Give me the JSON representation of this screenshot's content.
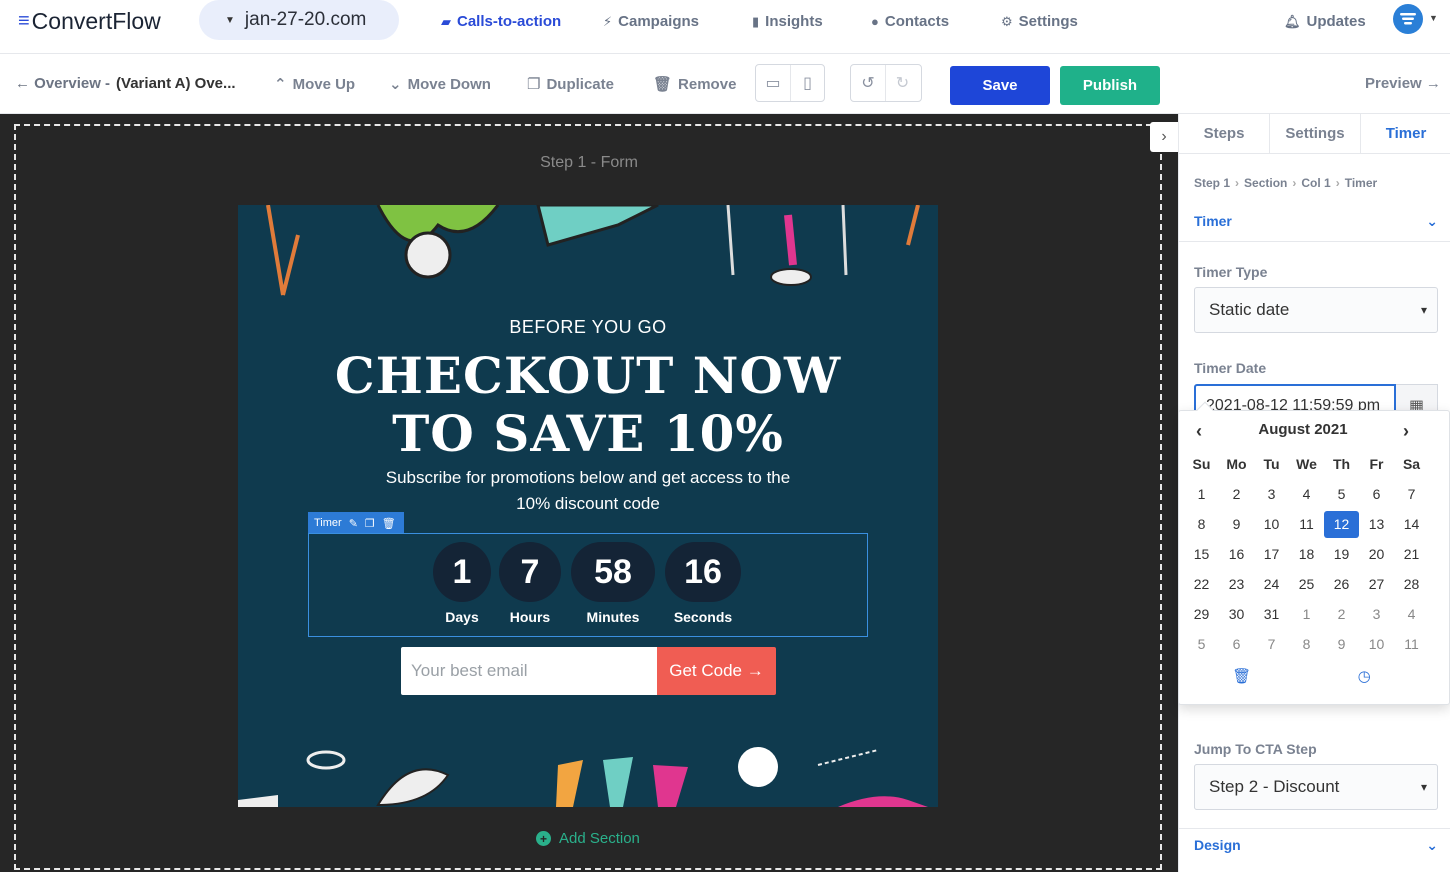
{
  "app": {
    "logo_text": "ConvertFlow",
    "domain": "jan-27-20.com"
  },
  "nav": {
    "items": [
      {
        "label": "Calls-to-action",
        "icon": "chat-icon",
        "active": true
      },
      {
        "label": "Campaigns",
        "icon": "bolt-icon",
        "active": false
      },
      {
        "label": "Insights",
        "icon": "bar-chart-icon",
        "active": false
      },
      {
        "label": "Contacts",
        "icon": "user-icon",
        "active": false
      },
      {
        "label": "Settings",
        "icon": "gear-icon",
        "active": false
      }
    ],
    "updates_label": "Updates"
  },
  "toolbar": {
    "back_label": "← Overview - ",
    "variant_label": "(Variant A) Ove...",
    "move_up": "Move Up",
    "move_down": "Move Down",
    "duplicate": "Duplicate",
    "remove": "Remove",
    "save": "Save",
    "publish": "Publish",
    "preview": "Preview →"
  },
  "canvas": {
    "step_label": "Step 1 - Form",
    "pre_headline": "BEFORE YOU GO",
    "headline_line1": "CHECKOUT NOW",
    "headline_line2": "TO SAVE 10%",
    "subtext": "Subscribe for promotions below and get access to the 10% discount code",
    "timer_tag": "Timer",
    "timer": [
      {
        "value": "1",
        "label": "Days"
      },
      {
        "value": "7",
        "label": "Hours"
      },
      {
        "value": "58",
        "label": "Minutes"
      },
      {
        "value": "16",
        "label": "Seconds"
      }
    ],
    "email_placeholder": "Your best email",
    "cta_button": "Get Code →",
    "add_section": "Add Section"
  },
  "panel": {
    "tabs": [
      "Steps",
      "Settings",
      "Timer"
    ],
    "active_tab": "Timer",
    "breadcrumbs": [
      "Step 1",
      "Section",
      "Col 1",
      "Timer"
    ],
    "timer_section": "Timer",
    "timer_type_label": "Timer Type",
    "timer_type_value": "Static date",
    "timer_date_label": "Timer Date",
    "timer_date_value": "2021-08-12 11:59:59 pm",
    "jump_label": "Jump To CTA Step",
    "jump_value": "Step 2 - Discount",
    "design_section": "Design"
  },
  "datepicker": {
    "month_title": "August 2021",
    "weekdays": [
      "Su",
      "Mo",
      "Tu",
      "We",
      "Th",
      "Fr",
      "Sa"
    ],
    "weeks": [
      [
        "1",
        "2",
        "3",
        "4",
        "5",
        "6",
        "7"
      ],
      [
        "8",
        "9",
        "10",
        "11",
        "12",
        "13",
        "14"
      ],
      [
        "15",
        "16",
        "17",
        "18",
        "19",
        "20",
        "21"
      ],
      [
        "22",
        "23",
        "24",
        "25",
        "26",
        "27",
        "28"
      ],
      [
        "29",
        "30",
        "31",
        "1",
        "2",
        "3",
        "4"
      ],
      [
        "5",
        "6",
        "7",
        "8",
        "9",
        "10",
        "11"
      ]
    ],
    "selected": "12",
    "colors": {
      "accent": "#2a6fd7"
    }
  },
  "colors": {
    "primary": "#1e46d8",
    "publish": "#1fb18a",
    "popup_bg": "#0f3a4e",
    "cta": "#f05d53",
    "canvas_bg": "#262626"
  }
}
